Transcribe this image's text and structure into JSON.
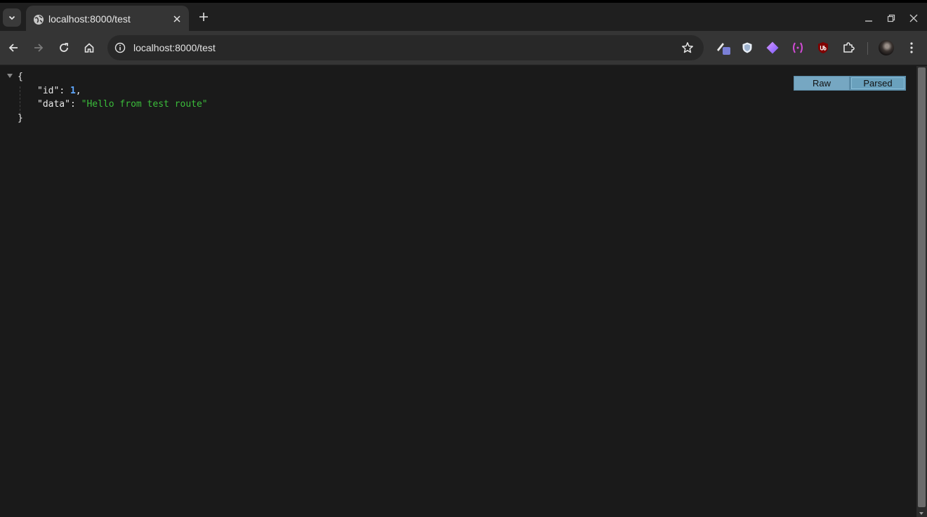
{
  "browser": {
    "tab": {
      "title": "localhost:8000/test",
      "favicon": "globe-icon"
    },
    "address": {
      "url": "localhost:8000/test"
    },
    "icons": {
      "tab_search": "chevron-down-icon",
      "new_tab": "plus-icon",
      "back": "arrow-left-icon",
      "forward": "arrow-right-icon",
      "reload": "reload-icon",
      "home": "home-icon",
      "site_info": "info-icon",
      "bookmark": "star-icon",
      "extensions": [
        "paint-brush-extension-icon",
        "shield-extension-icon",
        "diamond-extension-icon",
        "brackets-extension-icon",
        "ublock-extension-icon",
        "puzzle-icon"
      ],
      "menu": "kebab-menu-icon"
    },
    "colors": {
      "accent": "#76a7c2",
      "number": "#5fa8ff",
      "string": "#3bbd3b"
    }
  },
  "json_view": {
    "open_brace": "{",
    "close_brace": "}",
    "entries": [
      {
        "key": "\"id\"",
        "colon": ": ",
        "value": "1",
        "trail": ","
      },
      {
        "key": "\"data\"",
        "colon": ": ",
        "value": "\"Hello from test route\"",
        "trail": ""
      }
    ],
    "buttons": {
      "raw": "Raw",
      "parsed": "Parsed"
    }
  }
}
